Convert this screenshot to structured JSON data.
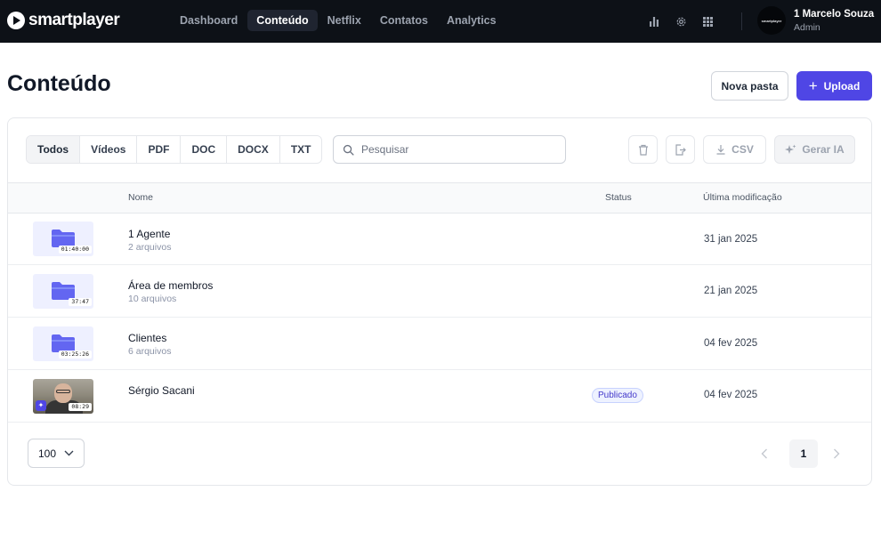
{
  "app": {
    "name": "smartplayer"
  },
  "nav": {
    "items": [
      {
        "label": "Dashboard",
        "active": false
      },
      {
        "label": "Conteúdo",
        "active": true
      },
      {
        "label": "Netflix",
        "active": false
      },
      {
        "label": "Contatos",
        "active": false
      },
      {
        "label": "Analytics",
        "active": false
      }
    ]
  },
  "top_icons": [
    "bar-chart-icon",
    "gear-icon",
    "grid-icon"
  ],
  "user": {
    "name": "1 Marcelo Souza",
    "role": "Admin",
    "avatar_text": "smartplayer"
  },
  "page": {
    "title": "Conteúdo",
    "new_folder_label": "Nova pasta",
    "upload_label": "Upload"
  },
  "filters": {
    "tabs": [
      "Todos",
      "Vídeos",
      "PDF",
      "DOC",
      "DOCX",
      "TXT"
    ],
    "active": "Todos"
  },
  "search": {
    "placeholder": "Pesquisar"
  },
  "actions": {
    "csv_label": "CSV",
    "ai_label": "Gerar IA"
  },
  "table": {
    "columns": {
      "name": "Nome",
      "status": "Status",
      "modified": "Última modificação"
    },
    "rows": [
      {
        "type": "folder",
        "name": "1 Agente",
        "sub": "2 arquivos",
        "duration": "01:40:00",
        "status": "",
        "date": "31 jan 2025"
      },
      {
        "type": "folder",
        "name": "Área de membros",
        "sub": "10 arquivos",
        "duration": "37:47",
        "status": "",
        "date": "21 jan 2025"
      },
      {
        "type": "folder",
        "name": "Clientes",
        "sub": "6 arquivos",
        "duration": "03:25:26",
        "status": "",
        "date": "04 fev 2025"
      },
      {
        "type": "video",
        "name": "Sérgio Sacani",
        "sub": "",
        "duration": "08:29",
        "status": "Publicado",
        "date": "04 fev 2025"
      }
    ]
  },
  "pagination": {
    "per_page": "100",
    "current_page": "1"
  },
  "colors": {
    "accent": "#4f46e5",
    "topbar": "#0d1117",
    "folder": "#6366f1"
  }
}
